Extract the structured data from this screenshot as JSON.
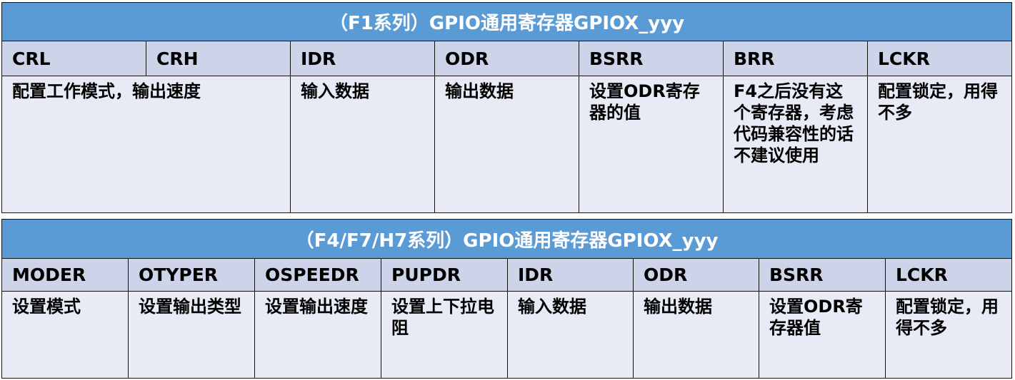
{
  "table1": {
    "title": "（F1系列）GPIO通用寄存器GPIOX_yyy",
    "headers": [
      "CRL",
      "CRH",
      "IDR",
      "ODR",
      "BSRR",
      "BRR",
      "LCKR"
    ],
    "descriptions": [
      "配置工作模式，输出速度",
      "输入数据",
      "输出数据",
      "设置ODR寄存器的值",
      "F4之后没有这个寄存器，考虑代码兼容性的话不建议使用",
      "配置锁定，用得不多"
    ]
  },
  "table2": {
    "title": "（F4/F7/H7系列）GPIO通用寄存器GPIOX_yyy",
    "headers": [
      "MODER",
      "OTYPER",
      "OSPEEDR",
      "PUPDR",
      "IDR",
      "ODR",
      "BSRR",
      "LCKR"
    ],
    "descriptions": [
      "设置模式",
      "设置输出类型",
      "设置输出速度",
      "设置上下拉电阻",
      "输入数据",
      "输出数据",
      "设置ODR寄存器值",
      "配置锁定，用得不多"
    ]
  }
}
